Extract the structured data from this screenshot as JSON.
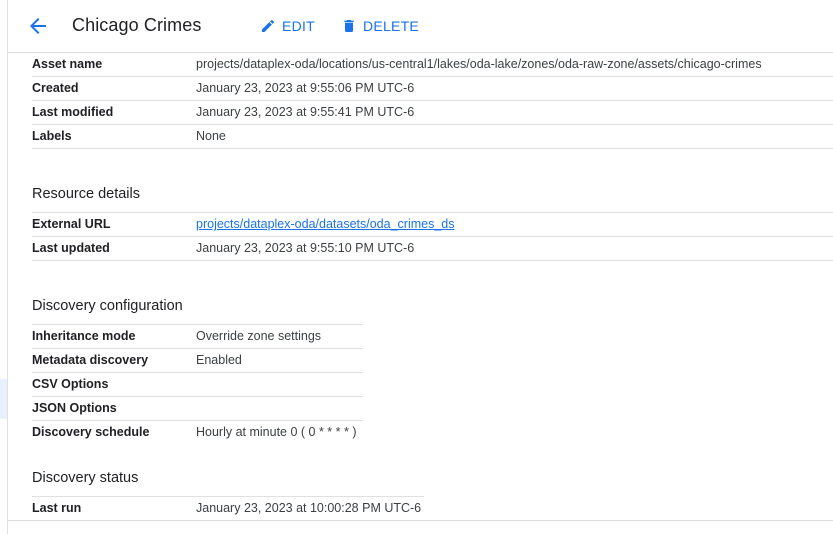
{
  "header": {
    "title": "Chicago Crimes",
    "edit_label": "EDIT",
    "delete_label": "DELETE"
  },
  "asset_rows": [
    {
      "key": "Asset name",
      "value": "projects/dataplex-oda/locations/us-central1/lakes/oda-lake/zones/oda-raw-zone/assets/chicago-crimes"
    },
    {
      "key": "Created",
      "value": "January 23, 2023 at 9:55:06 PM UTC-6"
    },
    {
      "key": "Last modified",
      "value": "January 23, 2023 at 9:55:41 PM UTC-6"
    },
    {
      "key": "Labels",
      "value": "None"
    }
  ],
  "resource_details": {
    "title": "Resource details",
    "rows": [
      {
        "key": "External URL",
        "value": "projects/dataplex-oda/datasets/oda_crimes_ds"
      },
      {
        "key": "Last updated",
        "value": "January 23, 2023 at 9:55:10 PM UTC-6"
      }
    ]
  },
  "discovery_configuration": {
    "title": "Discovery configuration",
    "rows": [
      {
        "key": "Inheritance mode",
        "value": "Override zone settings"
      },
      {
        "key": "Metadata discovery",
        "value": "Enabled"
      },
      {
        "key": "CSV Options",
        "value": ""
      },
      {
        "key": "JSON Options",
        "value": ""
      },
      {
        "key": "Discovery schedule",
        "value": "Hourly at minute 0 ( 0 * * * * )"
      }
    ]
  },
  "discovery_status": {
    "title": "Discovery status",
    "rows": [
      {
        "key": "Last run",
        "value": "January 23, 2023 at 10:00:28 PM UTC-6"
      }
    ]
  },
  "colors": {
    "accent": "#1a73e8",
    "text": "#202124",
    "divider": "#e0e0e0"
  }
}
